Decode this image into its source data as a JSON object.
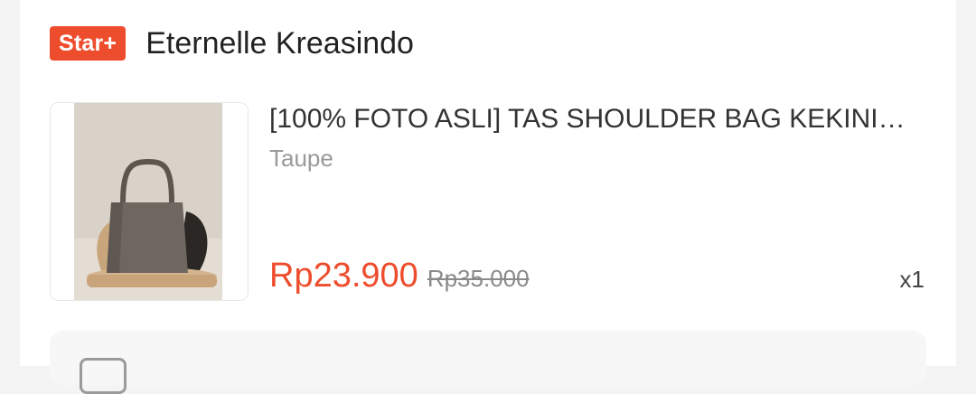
{
  "shop": {
    "badge": "Star+",
    "name": "Eternelle Kreasindo"
  },
  "product": {
    "image_icon": "shoulder-bag-photo",
    "title": "[100% FOTO ASLI] TAS SHOULDER BAG KEKINI…",
    "variant": "Taupe",
    "price": "Rp23.900",
    "original_price": "Rp35.000",
    "quantity": "x1"
  },
  "colors": {
    "accent": "#ee4d2d",
    "text_primary": "#222222",
    "text_muted": "#9a9a9a"
  }
}
